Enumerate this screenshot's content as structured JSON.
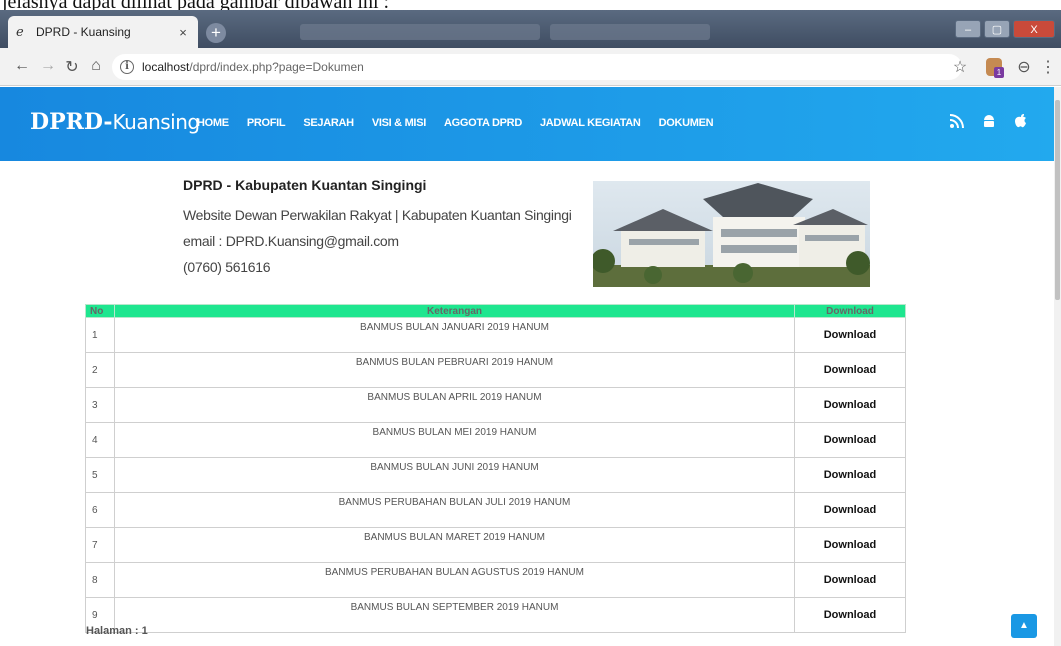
{
  "doc_caption": "jelasnya dapat dilihat pada gambar dibawah ini :",
  "browser": {
    "tab_title": "DPRD - Kuansing",
    "tab_close": "×",
    "new_tab": "+",
    "url_host": "localhost",
    "url_path": "/dprd/index.php?page=Dokumen",
    "window_controls": [
      "–",
      "▢",
      "X"
    ],
    "extension_badge": "1"
  },
  "site": {
    "brand_bold": "DPRD-",
    "brand_light": "Kuansing",
    "nav": [
      "HOME",
      "PROFIL",
      "SEJARAH",
      "VISI & MISI",
      "AGGOTA DPRD",
      "JADWAL KEGIATAN",
      "DOKUMEN"
    ],
    "header_icons": [
      "rss-icon",
      "android-icon",
      "apple-icon"
    ]
  },
  "info": {
    "title": "DPRD - Kabupaten Kuantan Singingi",
    "subtitle": "Website Dewan Perwakilan Rakyat | Kabupaten Kuantan Singingi",
    "email": "email : DPRD.Kuansing@gmail.com",
    "phone": "(0760) 561616"
  },
  "table": {
    "headers": [
      "No",
      "Keterangan",
      "Download"
    ],
    "rows": [
      {
        "no": "1",
        "ket": "BANMUS BULAN JANUARI 2019 HANUM",
        "dl": "Download"
      },
      {
        "no": "2",
        "ket": "BANMUS BULAN PEBRUARI 2019 HANUM",
        "dl": "Download"
      },
      {
        "no": "3",
        "ket": "BANMUS BULAN APRIL 2019 HANUM",
        "dl": "Download"
      },
      {
        "no": "4",
        "ket": "BANMUS BULAN MEI 2019 HANUM",
        "dl": "Download"
      },
      {
        "no": "5",
        "ket": "BANMUS BULAN JUNI 2019 HANUM",
        "dl": "Download"
      },
      {
        "no": "6",
        "ket": "BANMUS PERUBAHAN BULAN JULI 2019 HANUM",
        "dl": "Download"
      },
      {
        "no": "7",
        "ket": "BANMUS BULAN MARET 2019 HANUM",
        "dl": "Download"
      },
      {
        "no": "8",
        "ket": "BANMUS PERUBAHAN BULAN AGUSTUS 2019 HANUM",
        "dl": "Download"
      },
      {
        "no": "9",
        "ket": "BANMUS BULAN SEPTEMBER 2019 HANUM",
        "dl": "Download"
      }
    ]
  },
  "pager": "Halaman : 1",
  "colors": {
    "header_blue": "#1e9be8",
    "table_header_green": "#1ee68f"
  }
}
